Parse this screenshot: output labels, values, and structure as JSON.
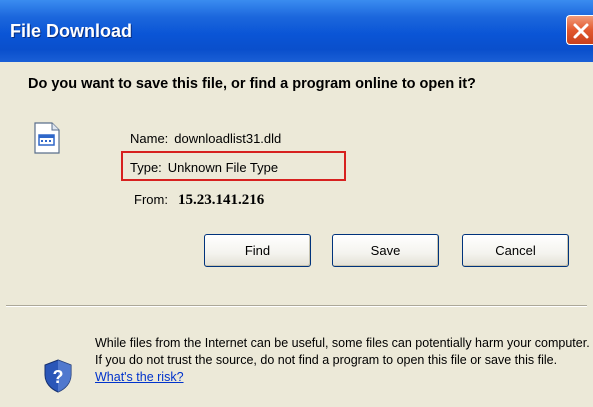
{
  "dialog": {
    "title": "File Download",
    "question": "Do you want to save this file, or find a program online to open it?",
    "file": {
      "icon": "unknown-file-icon",
      "name_label": "Name:",
      "name_value": "downloadlist31.dld",
      "type_label": "Type:",
      "type_value": "Unknown File Type",
      "from_label": "From:",
      "from_value": "15.23.141.216"
    },
    "buttons": {
      "find": "Find",
      "save": "Save",
      "cancel": "Cancel"
    },
    "warning": {
      "icon": "shield-question-icon",
      "text": "While files from the Internet can be useful, some files can potentially harm your computer. If you do not trust the source, do not find a program to open this file or save this file.",
      "link": "What's the risk?"
    }
  },
  "colors": {
    "titlebar": "#0a55d6",
    "dialog_bg": "#ece9d8",
    "highlight": "#d7211f",
    "close_button": "#e2592f",
    "link": "#0033cc"
  }
}
